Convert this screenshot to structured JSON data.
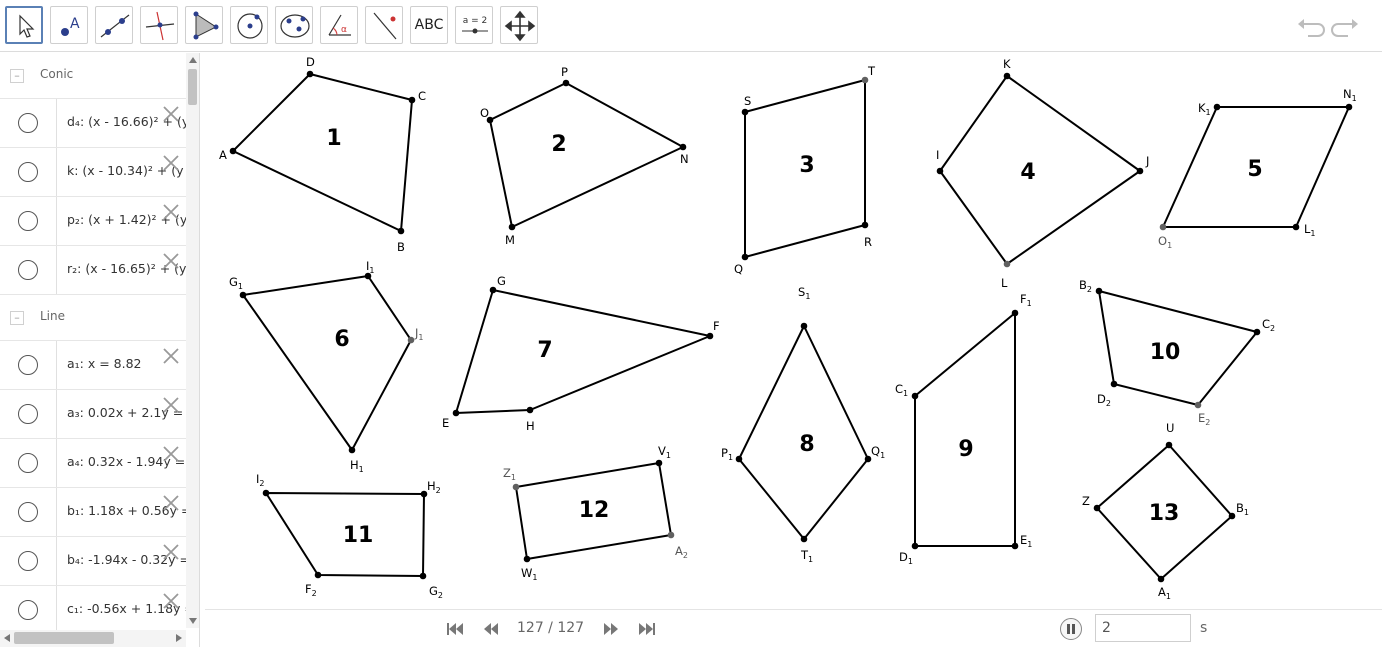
{
  "toolbar": {
    "tools": [
      {
        "name": "move-tool"
      },
      {
        "name": "point-tool"
      },
      {
        "name": "line-tool"
      },
      {
        "name": "perpendicular-tool"
      },
      {
        "name": "polygon-tool"
      },
      {
        "name": "circle-tool"
      },
      {
        "name": "ellipse-tool"
      },
      {
        "name": "angle-tool"
      },
      {
        "name": "reflect-tool"
      },
      {
        "name": "text-tool",
        "label": "ABC"
      },
      {
        "name": "slider-tool",
        "label": "a = 2"
      },
      {
        "name": "move-graphics-tool"
      }
    ],
    "undo_icon": "undo-icon",
    "redo_icon": "redo-icon"
  },
  "algebra": {
    "groups": [
      {
        "label": "Conic",
        "items": [
          {
            "text": "d₄: (x - 16.66)² + (y"
          },
          {
            "text": "k: (x - 10.34)² + (y"
          },
          {
            "text": "p₂: (x + 1.42)² + (y"
          },
          {
            "text": "r₂: (x - 16.65)² + (y"
          }
        ]
      },
      {
        "label": "Line",
        "items": [
          {
            "text": "a₁: x = 8.82"
          },
          {
            "text": "a₃: 0.02x + 2.1y = -"
          },
          {
            "text": "a₄: 0.32x - 1.94y ="
          },
          {
            "text": "b₁: 1.18x + 0.56y ="
          },
          {
            "text": "b₄: -1.94x - 0.32y ="
          },
          {
            "text": "c₁: -0.56x + 1.18y ="
          }
        ]
      }
    ]
  },
  "graphics": {
    "shapes": [
      {
        "id": "1"
      },
      {
        "id": "2"
      },
      {
        "id": "3"
      },
      {
        "id": "4"
      },
      {
        "id": "5"
      },
      {
        "id": "6"
      },
      {
        "id": "7"
      },
      {
        "id": "8"
      },
      {
        "id": "9"
      },
      {
        "id": "10"
      },
      {
        "id": "11"
      },
      {
        "id": "12"
      },
      {
        "id": "13"
      }
    ]
  },
  "bottom": {
    "step": "127 / 127",
    "speed_value": "2",
    "speed_unit": "s"
  },
  "colors": {
    "accent": "#5a80b5",
    "shape_stroke": "#000000",
    "point_grey": "#606060"
  }
}
